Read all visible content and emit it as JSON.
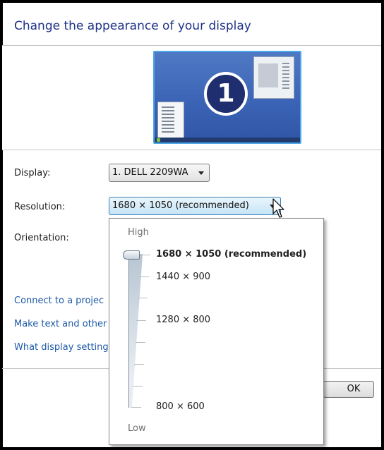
{
  "page": {
    "title": "Change the appearance of your display"
  },
  "monitor_preview": {
    "number": "1"
  },
  "settings": {
    "display_label": "Display:",
    "display_value": "1. DELL 2209WA",
    "resolution_label": "Resolution:",
    "resolution_value": "1680 × 1050 (recommended)",
    "orientation_label": "Orientation:"
  },
  "links": [
    "Connect to a projec",
    "Make text and other",
    "What display setting"
  ],
  "buttons": {
    "ok_label": "OK"
  },
  "resolution_dropdown": {
    "high_label": "High",
    "low_label": "Low",
    "options": [
      "1680 × 1050 (recommended)",
      "1440 × 900",
      "1280 × 800",
      "800 × 600"
    ],
    "selected_index": 0
  }
}
